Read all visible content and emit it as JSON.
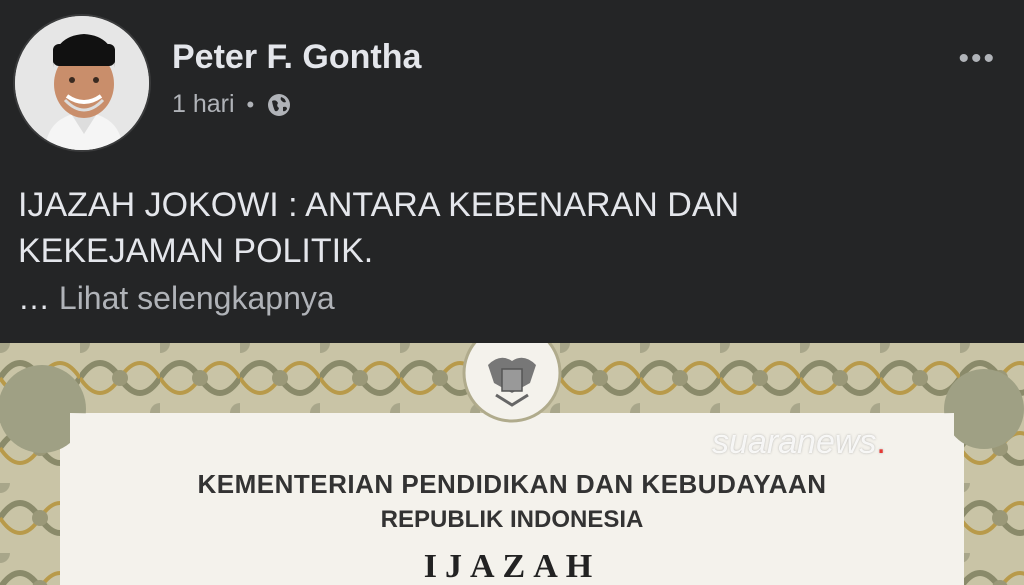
{
  "post": {
    "author": "Peter F. Gontha",
    "time": "1 hari",
    "separator": "•",
    "more_icon": "•••",
    "text_line1": "IJAZAH JOKOWI : ANTARA KEBENARAN DAN",
    "text_line2": "KEKEJAMAN POLITIK.",
    "ellipsis": "…",
    "see_more": "Lihat selengkapnya"
  },
  "image": {
    "line1": "KEMENTERIAN PENDIDIKAN DAN KEBUDAYAAN",
    "line2": "REPUBLIK INDONESIA",
    "title": "IJAZAH",
    "watermark": "suaranews",
    "watermark_dot": "."
  },
  "colors": {
    "background": "#242526",
    "text_primary": "#e4e6eb",
    "text_secondary": "#b0b3b8"
  }
}
